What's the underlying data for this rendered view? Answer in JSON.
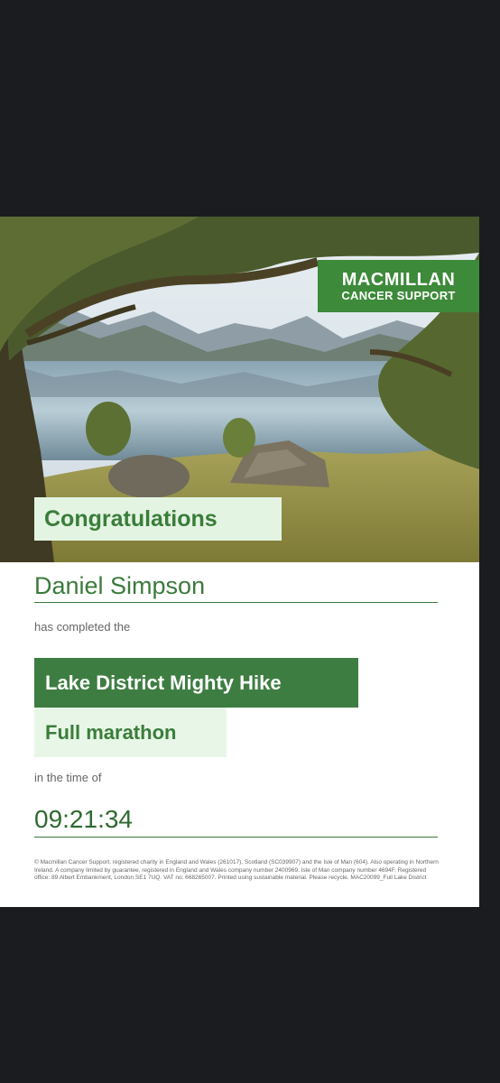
{
  "brand": {
    "line1": "MACMILLAN",
    "line2": "CANCER SUPPORT"
  },
  "certificate": {
    "heading": "Congratulations",
    "name": "Daniel Simpson",
    "completed_text": "has completed the",
    "event": "Lake District Mighty Hike",
    "distance": "Full marathon",
    "time_text": "in the time of",
    "time": "09:21:34",
    "legal": "© Macmillan Cancer Support, registered charity in England and Wales (261017), Scotland (SC039907) and the Isle of Man (604). Also operating in Northern Ireland. A company limited by guarantee, registered in England and Wales company number 2400969. Isle of Man company number 4694F. Registered office: 89 Albert Embankment, London SE1 7UQ. VAT no: 668265007. Printed using sustainable material. Please recycle. MAC20099_Full Lake District"
  },
  "colors": {
    "brand_green": "#3d8a3a",
    "dark_green": "#3e7d42",
    "light_green": "#e3f4e2",
    "background": "#1b1c20"
  }
}
